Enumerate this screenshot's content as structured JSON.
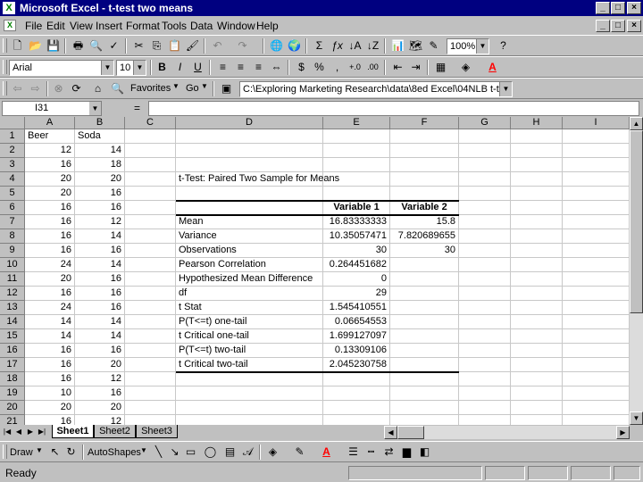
{
  "window": {
    "title": "Microsoft Excel - t-test two means"
  },
  "menu": [
    "File",
    "Edit",
    "View",
    "Insert",
    "Format",
    "Tools",
    "Data",
    "Window",
    "Help"
  ],
  "toolbar": {
    "zoom": "100%"
  },
  "format": {
    "font": "Arial",
    "size": "10"
  },
  "web": {
    "favorites": "Favorites",
    "go": "Go",
    "address": "C:\\Exploring Marketing Research\\data\\8ed Excel\\04NLB t-test.xls"
  },
  "formula_bar": {
    "name_box": "I31",
    "equals": "="
  },
  "columns": [
    "A",
    "B",
    "C",
    "D",
    "E",
    "F",
    "G",
    "H",
    "I"
  ],
  "rows": [
    "1",
    "2",
    "3",
    "4",
    "5",
    "6",
    "7",
    "8",
    "9",
    "10",
    "11",
    "12",
    "13",
    "14",
    "15",
    "16",
    "17",
    "18",
    "19",
    "20",
    "21"
  ],
  "colA": {
    "header": "Beer",
    "values": [
      "12",
      "16",
      "20",
      "20",
      "16",
      "16",
      "16",
      "16",
      "24",
      "20",
      "16",
      "24",
      "14",
      "14",
      "16",
      "16",
      "16",
      "10",
      "20",
      "16"
    ]
  },
  "colB": {
    "header": "Soda",
    "values": [
      "14",
      "18",
      "20",
      "16",
      "16",
      "12",
      "14",
      "16",
      "14",
      "16",
      "16",
      "16",
      "14",
      "14",
      "16",
      "20",
      "12",
      "16",
      "20",
      "12"
    ]
  },
  "ttest": {
    "title": "t-Test: Paired Two Sample for Means",
    "var1": "Variable 1",
    "var2": "Variable 2",
    "rows": [
      {
        "label": "Mean",
        "v1": "16.83333333",
        "v2": "15.8"
      },
      {
        "label": "Variance",
        "v1": "10.35057471",
        "v2": "7.820689655"
      },
      {
        "label": "Observations",
        "v1": "30",
        "v2": "30"
      },
      {
        "label": "Pearson Correlation",
        "v1": "0.264451682",
        "v2": ""
      },
      {
        "label": "Hypothesized Mean Difference",
        "v1": "0",
        "v2": ""
      },
      {
        "label": "df",
        "v1": "29",
        "v2": ""
      },
      {
        "label": "t Stat",
        "v1": "1.545410551",
        "v2": ""
      },
      {
        "label": "P(T<=t) one-tail",
        "v1": "0.06654553",
        "v2": ""
      },
      {
        "label": "t Critical one-tail",
        "v1": "1.699127097",
        "v2": ""
      },
      {
        "label": "P(T<=t) two-tail",
        "v1": "0.13309106",
        "v2": ""
      },
      {
        "label": "t Critical two-tail",
        "v1": "2.045230758",
        "v2": ""
      }
    ]
  },
  "sheets": [
    "Sheet1",
    "Sheet2",
    "Sheet3"
  ],
  "draw": {
    "draw_label": "Draw",
    "autoshapes_label": "AutoShapes"
  },
  "status": {
    "text": "Ready"
  },
  "colors": {
    "titlebar": "#000080",
    "chrome": "#c0c0c0",
    "font_red": "#ff0000"
  }
}
